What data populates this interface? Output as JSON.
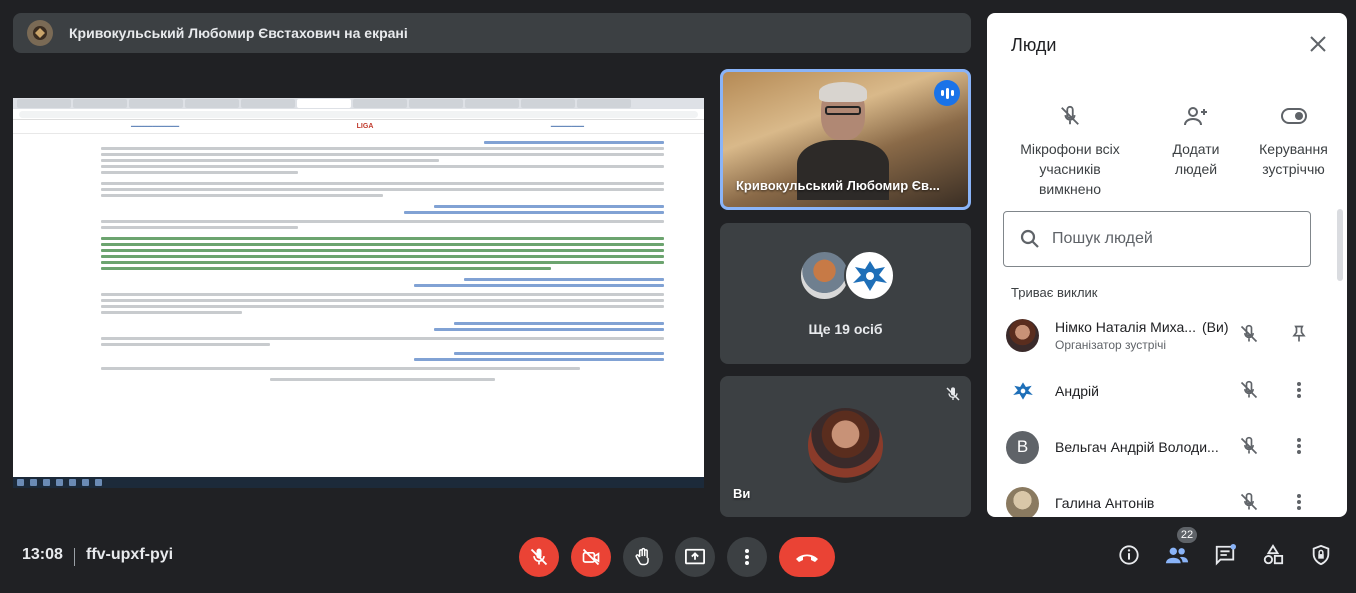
{
  "presenter": {
    "title": "Кривокульський Любомир Євстахович на екрані"
  },
  "shared_screen": {
    "liga_logo": "LIGA"
  },
  "tiles": {
    "main_speaker": "Кривокульський Любомир Єв...",
    "others": "Ще 19 осіб",
    "self": "Ви"
  },
  "people_panel": {
    "title": "Люди",
    "actions": [
      {
        "label": "Мікрофони всіх учасників вимкнено",
        "icon": "mic-off-icon"
      },
      {
        "label": "Додати людей",
        "icon": "add-person-icon"
      },
      {
        "label": "Керування зустріччю",
        "icon": "toggle-icon"
      }
    ],
    "search_placeholder": "Пошук людей",
    "section": "Триває виклик",
    "participants": [
      {
        "name": "Німко Наталія Миха...",
        "you": "(Ви)",
        "subtitle": "Організатор зустрічі",
        "initial": ""
      },
      {
        "name": "Андрій",
        "initial": ""
      },
      {
        "name": "Вельгач Андрій Володи...",
        "initial": "В"
      },
      {
        "name": "Галина Антонів",
        "initial": ""
      }
    ]
  },
  "bottom_bar": {
    "time": "13:08",
    "meeting_code": "ffv-upxf-pyi",
    "people_count": "22"
  },
  "colors": {
    "background": "#202124",
    "tile": "#3c4043",
    "danger": "#ea4335",
    "accent": "#1a73e8",
    "active_border": "#8ab4f8"
  }
}
